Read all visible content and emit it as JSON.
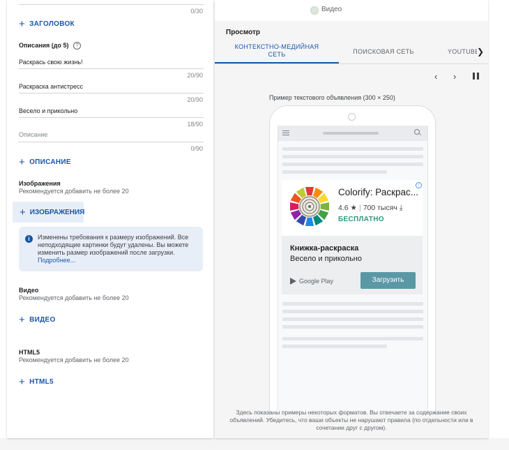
{
  "left": {
    "top_counter": "0/30",
    "add_headline": "ЗАГОЛОВОК",
    "descriptions_title": "Описания (до 5)",
    "descriptions": [
      {
        "value": "Раскрась свою жизнь!",
        "counter": "20/90"
      },
      {
        "value": "Раскраска антистресс",
        "counter": "20/90"
      },
      {
        "value": "Весело и прикольно",
        "counter": "18/90"
      },
      {
        "placeholder": "Описание",
        "counter": "0/90"
      }
    ],
    "add_description": "ОПИСАНИЕ",
    "images_title": "Изображения",
    "images_sub": "Рекомендуется добавить не более 20",
    "add_images": "ИЗОБРАЖЕНИЯ",
    "info_text": "Изменены требования к размеру изображений. Все неподходящие картинки будут удалены. Вы можете изменить размер изображений после загрузки.",
    "info_link": "Подробнее...",
    "video_title": "Видео",
    "video_sub": "Рекомендуется добавить не более 20",
    "add_video": "ВИДЕО",
    "html5_title": "HTML5",
    "html5_sub": "Рекомендуется добавить не более 20",
    "add_html5": "HTML5"
  },
  "right": {
    "video_option": "Видео",
    "preview_title": "Просмотр",
    "tabs": [
      "КОНТЕКСТНО-МЕДИЙНАЯ СЕТЬ",
      "ПОИСКОВАЯ СЕТЬ",
      "YOUTUBE"
    ],
    "sample_label": "Пример текстового объявления (300 × 250)",
    "ad": {
      "app_name": "Colorify: Раскрас...",
      "rating": "4.6",
      "installs": "700 тысяч",
      "price": "БЕСПЛАТНО",
      "headline": "Книжка-раскраска",
      "description": "Весело и прикольно",
      "store": "Google Play",
      "cta": "Загрузить"
    },
    "disclaimer": "Здесь показаны примеры некоторых форматов. Вы отвечаете за содержание своих объявлений. Убедитесь, что ваши объекты не нарушают правила (по отдельности или в сочетании друг с другом)."
  },
  "colors": {
    "accent": "#1a56a8",
    "price_green": "#2d9a7e",
    "cta_bg": "#5b98a6",
    "info_bg": "#e8eef7"
  }
}
